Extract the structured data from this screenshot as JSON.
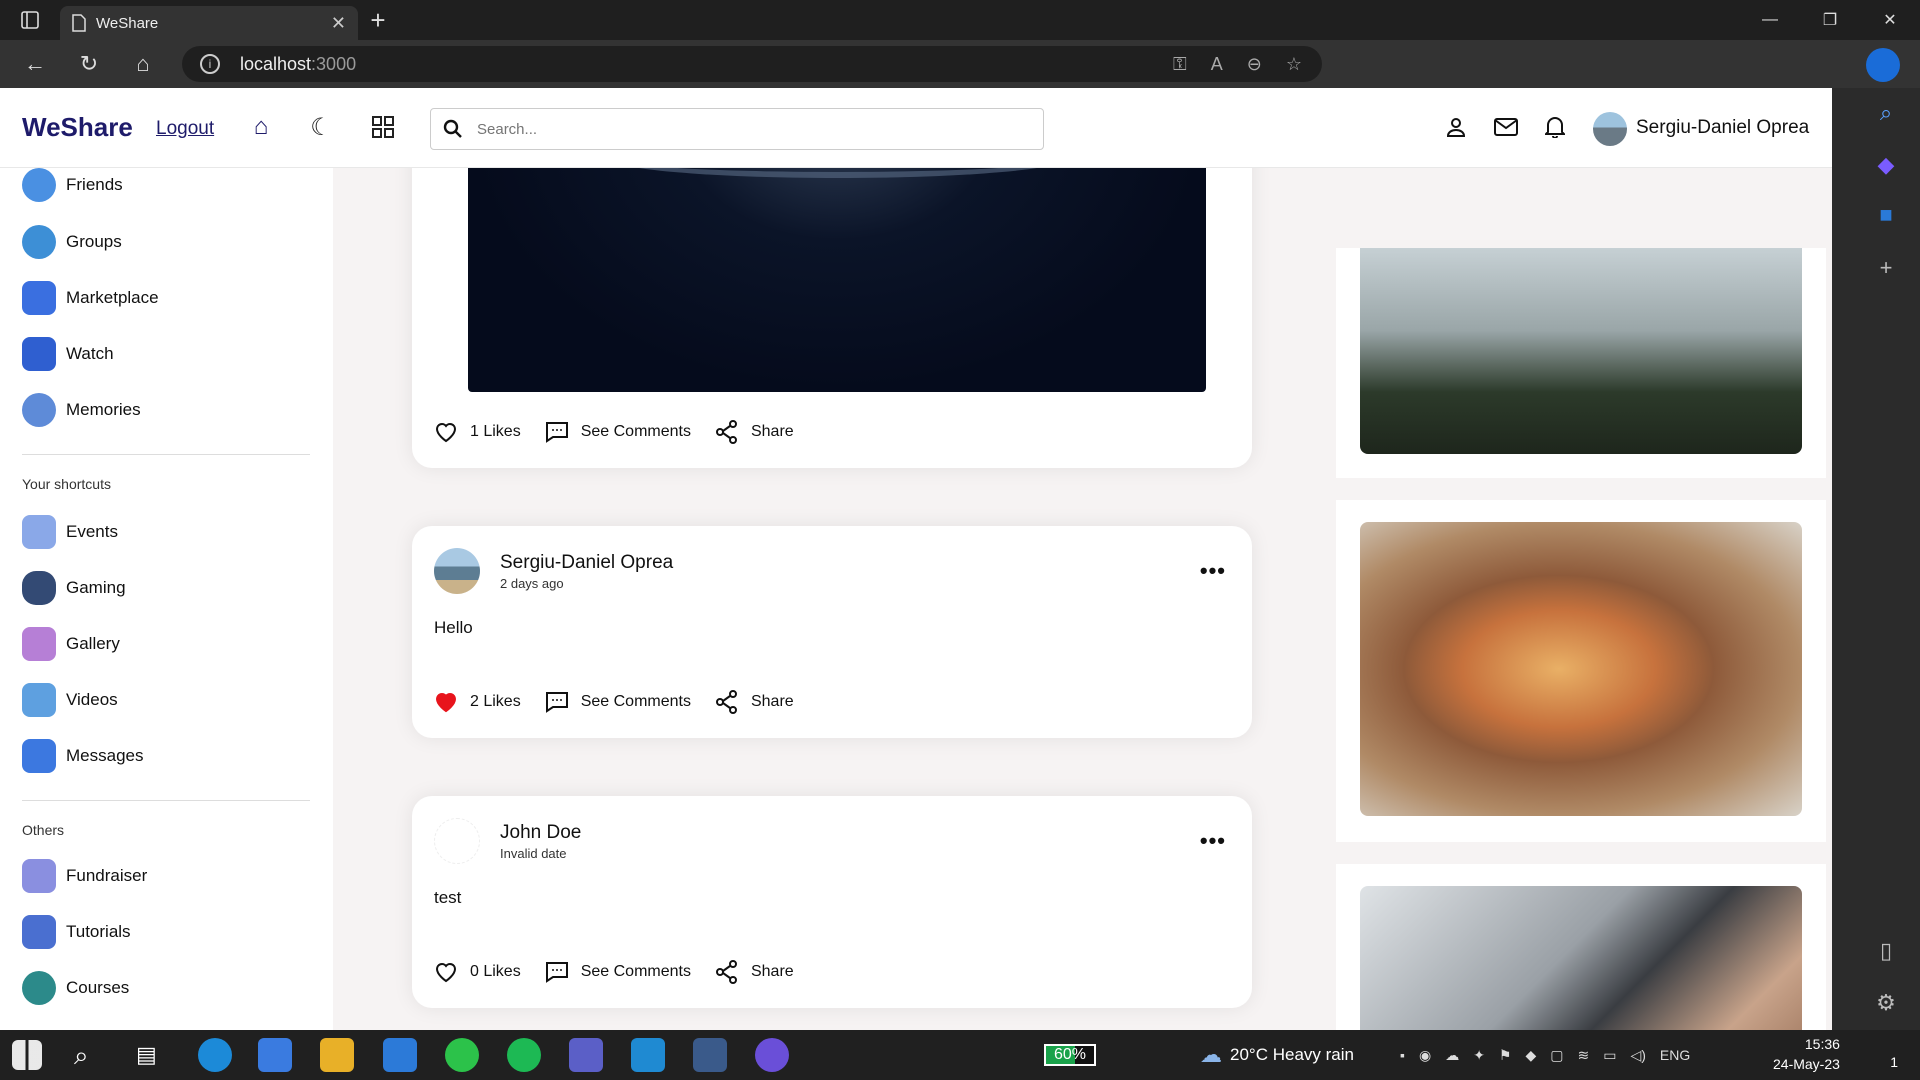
{
  "browser": {
    "tab_title": "WeShare",
    "url_host": "localhost",
    "url_port": ":3000"
  },
  "app": {
    "logo": "WeShare",
    "logout": "Logout",
    "search_placeholder": "Search...",
    "username": "Sergiu-Daniel Oprea"
  },
  "sidebar": {
    "items": [
      {
        "label": "Friends",
        "color": "#4a90e2"
      },
      {
        "label": "Groups",
        "color": "#3d8fd6"
      },
      {
        "label": "Marketplace",
        "color": "#3a6fe0"
      },
      {
        "label": "Watch",
        "color": "#2f5fd0"
      },
      {
        "label": "Memories",
        "color": "#5e8bd8"
      }
    ],
    "shortcuts_title": "Your shortcuts",
    "shortcuts": [
      {
        "label": "Events",
        "color": "#8aa8e8"
      },
      {
        "label": "Gaming",
        "color": "#334a74"
      },
      {
        "label": "Gallery",
        "color": "#b67fd6"
      },
      {
        "label": "Videos",
        "color": "#5ea0e0"
      },
      {
        "label": "Messages",
        "color": "#3c78e0"
      }
    ],
    "others_title": "Others",
    "others": [
      {
        "label": "Fundraiser",
        "color": "#8a8fe0"
      },
      {
        "label": "Tutorials",
        "color": "#4a6fd0"
      },
      {
        "label": "Courses",
        "color": "#2c8a8a"
      }
    ]
  },
  "posts": [
    {
      "likes": "1 Likes",
      "comments": "See Comments",
      "share": "Share",
      "liked": false
    },
    {
      "author": "Sergiu-Daniel Oprea",
      "date": "2 days ago",
      "text": "Hello",
      "likes": "2 Likes",
      "comments": "See Comments",
      "share": "Share",
      "liked": true
    },
    {
      "author": "John Doe",
      "date": "Invalid date",
      "text": "test",
      "likes": "0 Likes",
      "comments": "See Comments",
      "share": "Share",
      "liked": false
    }
  ],
  "taskbar": {
    "battery": "60%",
    "weather": "20°C  Heavy rain",
    "language": "ENG",
    "time": "15:36",
    "date": "24-May-23",
    "notifications": "1"
  }
}
